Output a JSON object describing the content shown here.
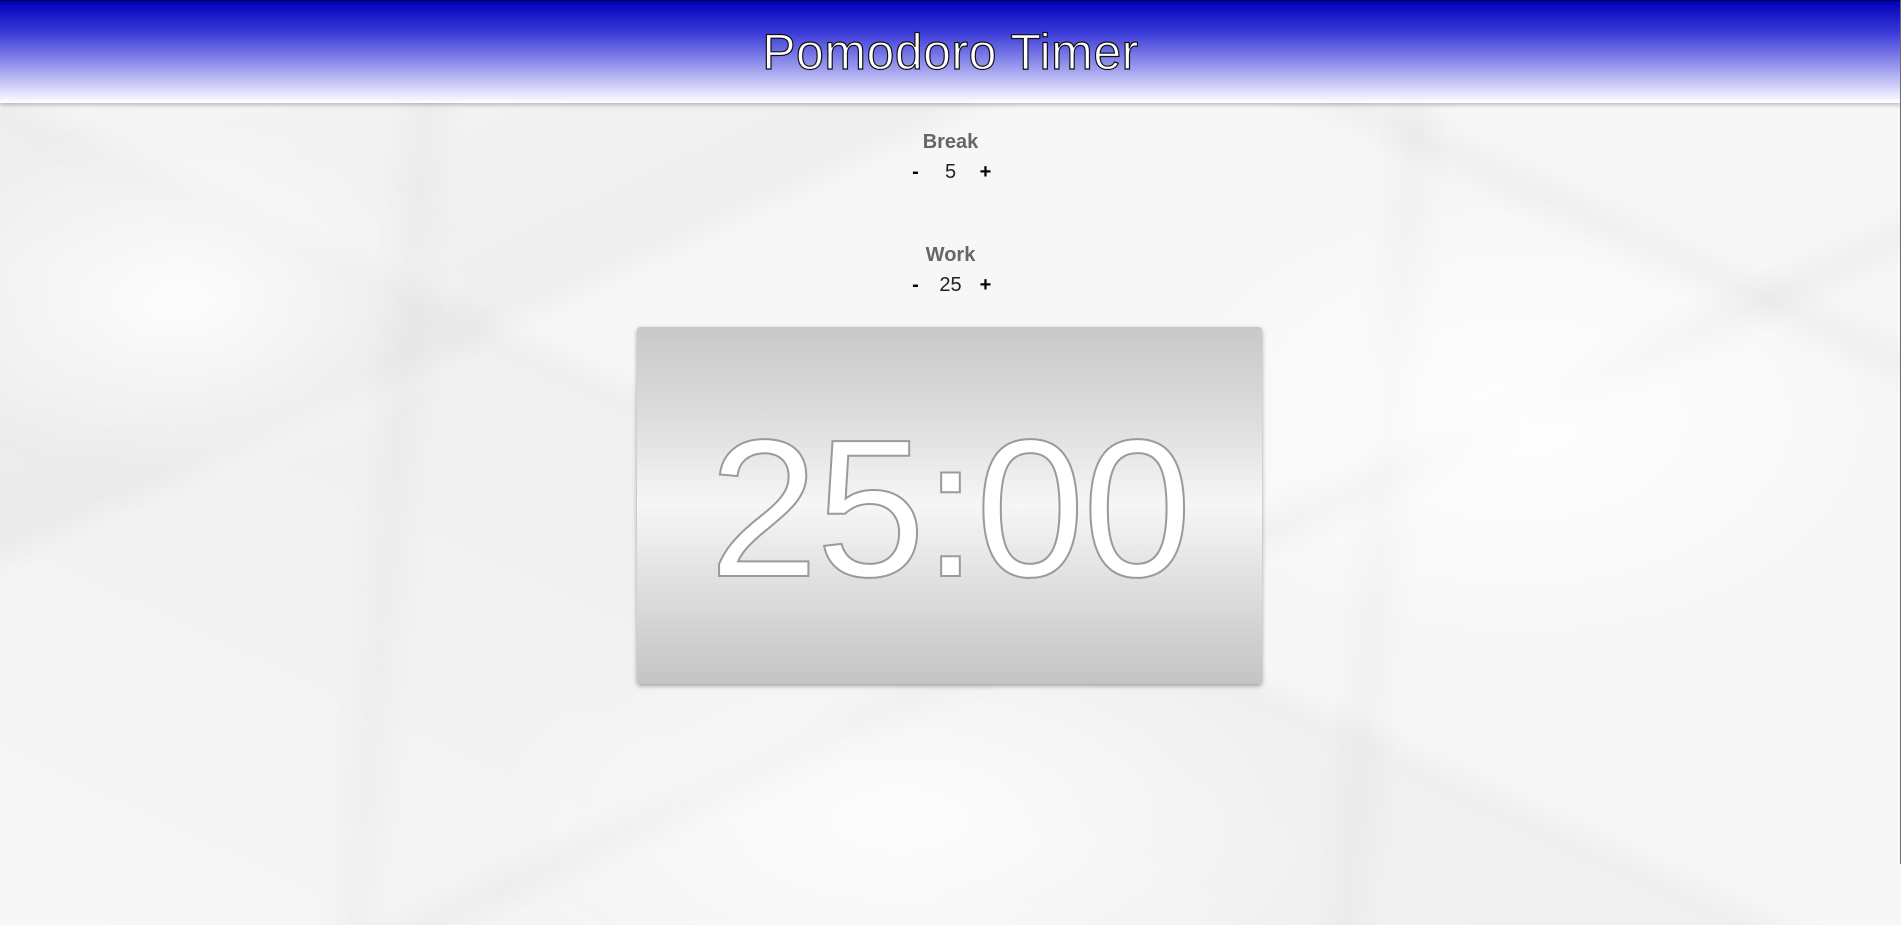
{
  "header": {
    "title": "Pomodoro Timer"
  },
  "break_setting": {
    "label": "Break",
    "decrement_label": "-",
    "value": "5",
    "increment_label": "+"
  },
  "work_setting": {
    "label": "Work",
    "decrement_label": "-",
    "value": "25",
    "increment_label": "+"
  },
  "clock": {
    "time": "25:00"
  },
  "colors": {
    "header_top": "#0000b8",
    "header_bottom": "#ffffff",
    "label_color": "#666666",
    "clock_text_outline": "#9a9a9a"
  }
}
